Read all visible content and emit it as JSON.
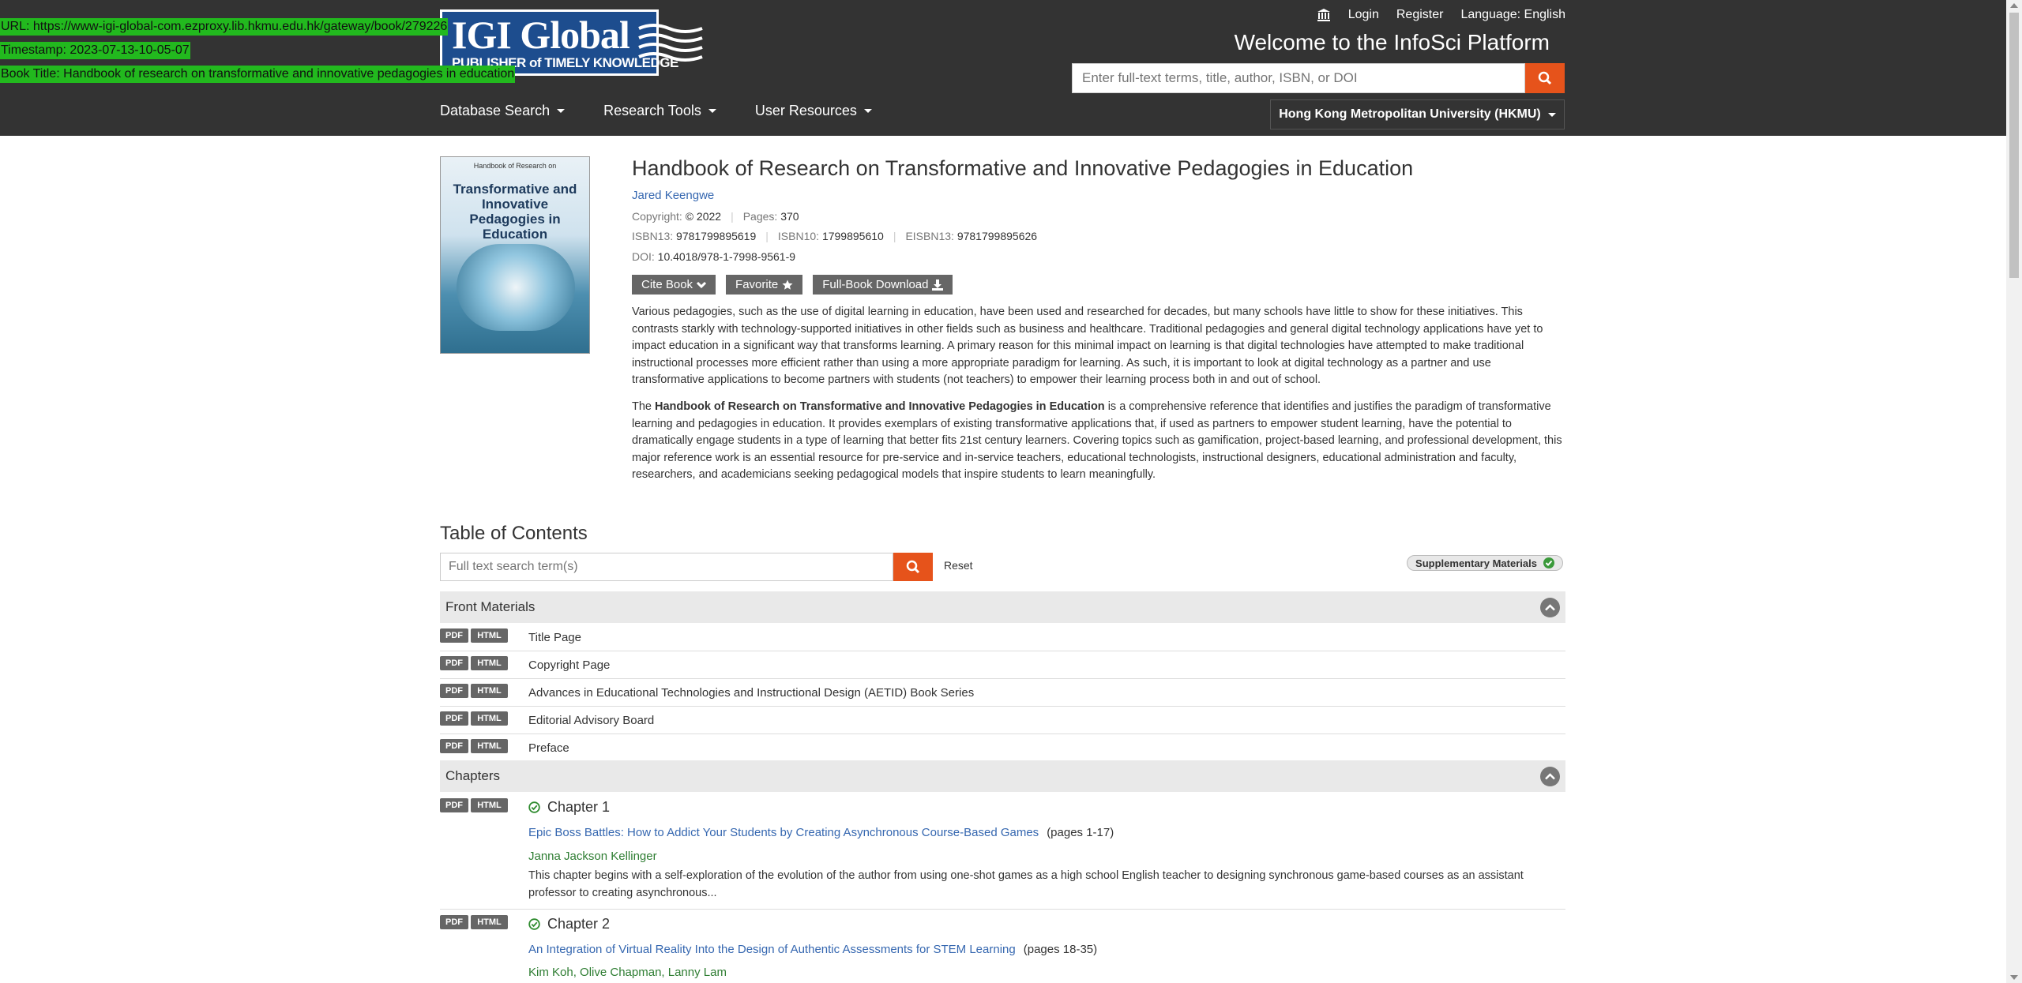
{
  "overlay": {
    "url": "URL: https://www-igi-global-com.ezproxy.lib.hkmu.edu.hk/gateway/book/279226",
    "timestamp": "Timestamp: 2023-07-13-10-05-07",
    "book_title": "Book Title: Handbook of research on transformative and innovative pedagogies in education"
  },
  "header": {
    "logo_name": "IGI Global",
    "logo_tagline": "PUBLISHER of TIMELY KNOWLEDGE",
    "login": "Login",
    "register": "Register",
    "language": "Language: English",
    "welcome": "Welcome to the InfoSci Platform",
    "search_placeholder": "Enter full-text terms, title, author, ISBN, or DOI",
    "nav": [
      "Database Search",
      "Research Tools",
      "User Resources"
    ],
    "institution": "Hong Kong Metropolitan University (HKMU)"
  },
  "book": {
    "cover_series": "Handbook of Research on",
    "cover_title": "Transformative and Innovative Pedagogies in Education",
    "title": "Handbook of Research on Transformative and Innovative Pedagogies in Education",
    "author": "Jared Keengwe",
    "copyright_label": "Copyright:",
    "copyright": "© 2022",
    "pages_label": "Pages:",
    "pages": "370",
    "isbn13_label": "ISBN13:",
    "isbn13": "9781799895619",
    "isbn10_label": "ISBN10:",
    "isbn10": "1799895610",
    "eisbn13_label": "EISBN13:",
    "eisbn13": "9781799895626",
    "doi_label": "DOI:",
    "doi": "10.4018/978-1-7998-9561-9",
    "buttons": {
      "cite": "Cite Book",
      "favorite": "Favorite",
      "download": "Full-Book Download"
    },
    "description_1": "Various pedagogies, such as the use of digital learning in education, have been used and researched for decades, but many schools have little to show for these initiatives. This contrasts starkly with technology-supported initiatives in other fields such as business and healthcare. Traditional pedagogies and general digital technology applications have yet to impact education in a significant way that transforms learning. A primary reason for this minimal impact on learning is that digital technologies have attempted to make traditional instructional processes more efficient rather than using a more appropriate paradigm for learning. As such, it is important to look at digital technology as a partner and use transformative applications to become partners with students (not teachers) to empower their learning process both in and out of school.",
    "description_2_prefix": "The ",
    "description_2_bold": "Handbook of Research on Transformative and Innovative Pedagogies in Education",
    "description_2_rest": " is a comprehensive reference that identifies and justifies the paradigm of transformative learning and pedagogies in education. It provides exemplars of existing transformative applications that, if used as partners to empower student learning, have the potential to dramatically engage students in a type of learning that better fits 21st century learners. Covering topics such as gamification, project-based learning, and professional development, this major reference work is an essential resource for pre-service and in-service teachers, educational technologists, instructional designers, educational administration and faculty, researchers, and academicians seeking pedagogical models that inspire students to learn meaningfully."
  },
  "toc": {
    "title": "Table of Contents",
    "search_placeholder": "Full text search term(s)",
    "reset": "Reset",
    "supplementary": "Supplementary Materials",
    "pdf": "PDF",
    "html": "HTML",
    "front_materials_label": "Front Materials",
    "front_items": [
      "Title Page",
      "Copyright Page",
      "Advances in Educational Technologies and Instructional Design (AETID) Book Series",
      "Editorial Advisory Board",
      "Preface"
    ],
    "chapters_label": "Chapters",
    "chapters": [
      {
        "number": "Chapter 1",
        "title": "Epic Boss Battles: How to Addict Your Students by Creating Asynchronous Course-Based Games",
        "pages": "(pages 1-17)",
        "authors": "Janna Jackson Kellinger",
        "abstract": "This chapter begins with a self-exploration of the evolution of the author from using one-shot games as a high school English teacher to designing synchronous game-based courses as an assistant professor to creating asynchronous..."
      },
      {
        "number": "Chapter 2",
        "title": "An Integration of Virtual Reality Into the Design of Authentic Assessments for STEM Learning",
        "pages": "(pages 18-35)",
        "authors": "Kim Koh, Olive Chapman, Lanny Lam",
        "abstract": ""
      }
    ]
  }
}
